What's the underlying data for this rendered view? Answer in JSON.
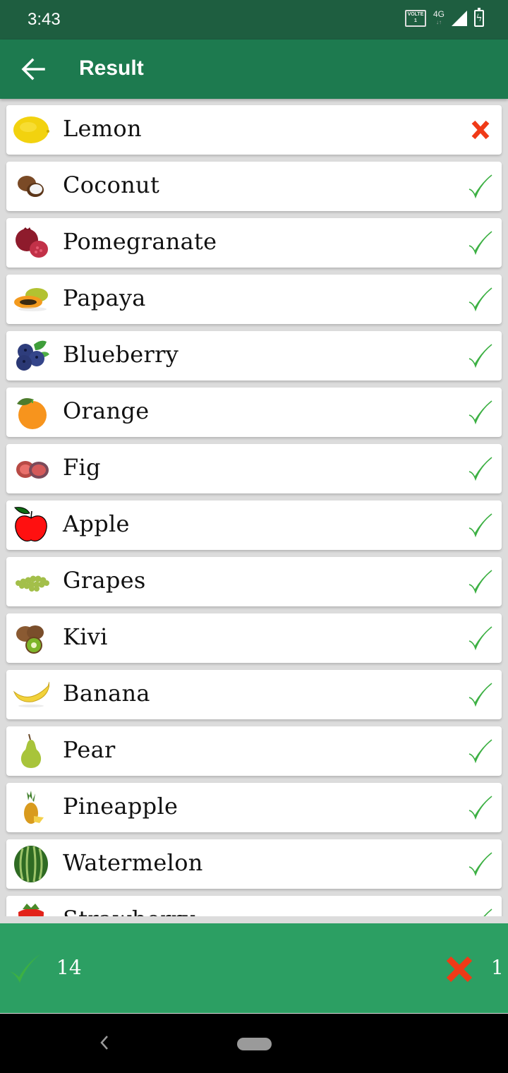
{
  "status_bar": {
    "time": "3:43",
    "volte_label": "VOLTE",
    "volte_sim": "1",
    "network": "4G",
    "icons": [
      "volte-icon",
      "network-4g-icon",
      "signal-icon",
      "battery-charging-icon"
    ]
  },
  "app_bar": {
    "back_icon": "arrow-left-icon",
    "title": "Result"
  },
  "results": [
    {
      "name": "Lemon",
      "icon": "lemon-icon",
      "status": "wrong"
    },
    {
      "name": "Coconut",
      "icon": "coconut-icon",
      "status": "correct"
    },
    {
      "name": "Pomegranate",
      "icon": "pomegranate-icon",
      "status": "correct"
    },
    {
      "name": "Papaya",
      "icon": "papaya-icon",
      "status": "correct"
    },
    {
      "name": "Blueberry",
      "icon": "blueberry-icon",
      "status": "correct"
    },
    {
      "name": "Orange",
      "icon": "orange-icon",
      "status": "correct"
    },
    {
      "name": "Fig",
      "icon": "fig-icon",
      "status": "correct"
    },
    {
      "name": "Apple",
      "icon": "apple-icon",
      "status": "correct"
    },
    {
      "name": "Grapes",
      "icon": "grapes-icon",
      "status": "correct"
    },
    {
      "name": "Kivi",
      "icon": "kiwi-icon",
      "status": "correct"
    },
    {
      "name": "Banana",
      "icon": "banana-icon",
      "status": "correct"
    },
    {
      "name": "Pear",
      "icon": "pear-icon",
      "status": "correct"
    },
    {
      "name": "Pineapple",
      "icon": "pineapple-icon",
      "status": "correct"
    },
    {
      "name": "Watermelon",
      "icon": "watermelon-icon",
      "status": "correct"
    },
    {
      "name": "Strawberry",
      "icon": "strawberry-icon",
      "status": "correct"
    }
  ],
  "summary": {
    "correct_count": "14",
    "wrong_count": "1"
  },
  "colors": {
    "status_bar": "#1e5e40",
    "app_bar": "#1d7a4f",
    "summary_bar": "#2c9f63",
    "correct": "#3cb043",
    "wrong": "#f03a17"
  },
  "nav_bar": {
    "icons": [
      "nav-back-icon",
      "nav-home-pill"
    ]
  }
}
